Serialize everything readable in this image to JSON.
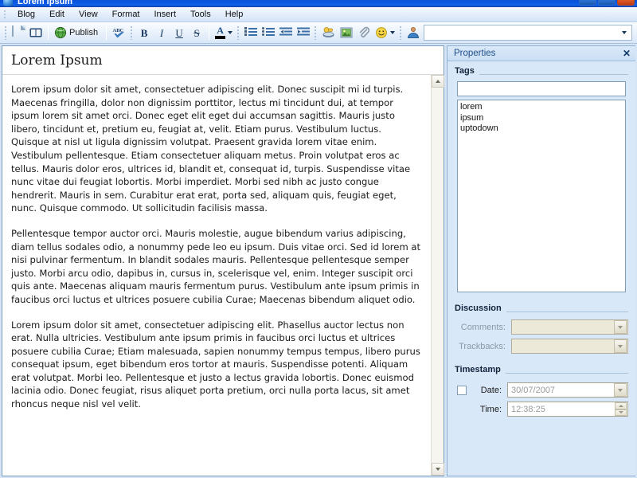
{
  "window": {
    "title": "Lorem Ipsum",
    "controls": [
      "minimize",
      "maximize",
      "close"
    ]
  },
  "menubar": {
    "items": [
      {
        "label": "Blog",
        "name": "menu-blog"
      },
      {
        "label": "Edit",
        "name": "menu-edit"
      },
      {
        "label": "View",
        "name": "menu-view"
      },
      {
        "label": "Format",
        "name": "menu-format"
      },
      {
        "label": "Insert",
        "name": "menu-insert"
      },
      {
        "label": "Tools",
        "name": "menu-tools"
      },
      {
        "label": "Help",
        "name": "menu-help"
      }
    ]
  },
  "toolbar": {
    "new_post": "new-post-icon",
    "open_post": "open-book-icon",
    "publish_label": "Publish",
    "publish_icon": "globe-icon",
    "spellcheck_icon": "spellcheck-abc-icon",
    "bold": "B",
    "italic": "I",
    "underline": "U",
    "strikethrough": "S",
    "font_color_letter": "A",
    "font_color_hex": "#000000",
    "numbered_list": "numbered-list-icon",
    "bulleted_list": "bulleted-list-icon",
    "decrease_indent": "decrease-indent-icon",
    "increase_indent": "increase-indent-icon",
    "insert_link": "insert-link-icon",
    "insert_image": "insert-image-icon",
    "attach_file": "paperclip-icon",
    "insert_emoticon": "smiley-icon",
    "author_icon": "user-avatar-icon",
    "author_value": ""
  },
  "editor": {
    "title": "Lorem Ipsum",
    "paragraphs": [
      "Lorem ipsum dolor sit amet, consectetuer adipiscing elit. Donec suscipit mi id turpis. Maecenas fringilla, dolor non dignissim porttitor, lectus mi tincidunt dui, at tempor ipsum lorem sit amet orci. Donec eget elit eget dui accumsan sagittis. Mauris justo libero, tincidunt et, pretium eu, feugiat at, velit. Etiam purus. Vestibulum luctus. Quisque at nisl ut ligula dignissim volutpat. Praesent gravida lorem vitae enim. Vestibulum pellentesque. Etiam consectetuer aliquam metus. Proin volutpat eros ac tellus. Mauris dolor eros, ultrices id, blandit et, consequat id, turpis. Suspendisse vitae nunc vitae dui feugiat lobortis. Morbi imperdiet. Morbi sed nibh ac justo congue hendrerit. Mauris in sem. Curabitur erat erat, porta sed, aliquam quis, feugiat eget, nunc. Quisque commodo. Ut sollicitudin facilisis massa.",
      "Pellentesque tempor auctor orci. Mauris molestie, augue bibendum varius adipiscing, diam tellus sodales odio, a nonummy pede leo eu ipsum. Duis vitae orci. Sed id lorem at nisi pulvinar fermentum. In blandit sodales mauris. Pellentesque pellentesque semper justo. Morbi arcu odio, dapibus in, cursus in, scelerisque vel, enim. Integer suscipit orci quis ante. Maecenas aliquam mauris fermentum purus. Vestibulum ante ipsum primis in faucibus orci luctus et ultrices posuere cubilia Curae; Maecenas bibendum aliquet odio.",
      "Lorem ipsum dolor sit amet, consectetuer adipiscing elit. Phasellus auctor lectus non erat. Nulla ultricies. Vestibulum ante ipsum primis in faucibus orci luctus et ultrices posuere cubilia Curae; Etiam malesuada, sapien nonummy tempus tempus, libero purus consequat ipsum, eget bibendum eros tortor at mauris. Suspendisse potenti. Aliquam erat volutpat. Morbi leo. Pellentesque et justo a lectus gravida lobortis. Donec euismod lacinia odio. Donec feugiat, risus aliquet porta pretium, orci nulla porta lacus, sit amet rhoncus neque nisl vel velit."
    ]
  },
  "properties": {
    "panel_title": "Properties",
    "close_label": "✕",
    "tags": {
      "section_title": "Tags",
      "input_value": "",
      "items": [
        "lorem",
        "ipsum",
        "uptodown"
      ]
    },
    "discussion": {
      "section_title": "Discussion",
      "comments_label": "Comments:",
      "comments_value": "",
      "trackbacks_label": "Trackbacks:",
      "trackbacks_value": ""
    },
    "timestamp": {
      "section_title": "Timestamp",
      "date_label": "Date:",
      "date_value": "30/07/2007",
      "date_checked": false,
      "time_label": "Time:",
      "time_value": "12:38:25"
    }
  },
  "scrollbar": {
    "up_arrow": "scroll-up-arrow",
    "down_arrow": "scroll-down-arrow"
  },
  "colors": {
    "titlebar_blue": "#0a52d6",
    "panel_blue": "#d9e8f8",
    "accent": "#1d4e89",
    "disabled_field": "#ece9d8"
  }
}
